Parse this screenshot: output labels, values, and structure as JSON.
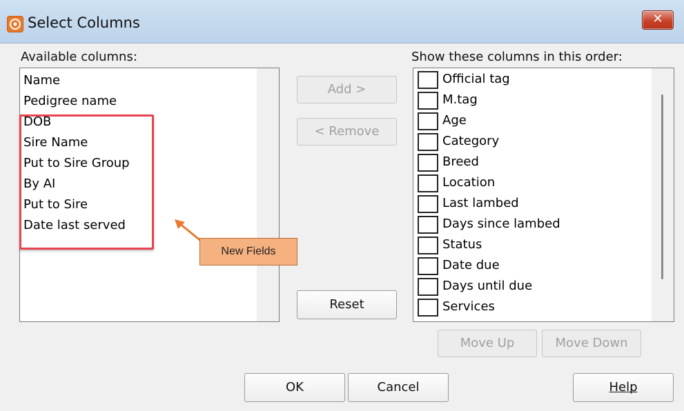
{
  "window": {
    "title": "Select Columns",
    "close_label": "✕"
  },
  "available": {
    "label": "Available columns:",
    "items": [
      "Name",
      "Pedigree name",
      "DOB",
      "Sire Name",
      "Put to Sire Group",
      "By AI",
      "Put to Sire",
      "Date last served"
    ]
  },
  "middle_buttons": {
    "add": "Add >",
    "remove": "< Remove",
    "reset": "Reset"
  },
  "shown": {
    "label": "Show these columns in this order:",
    "items": [
      "Official tag",
      "M.tag",
      "Age",
      "Category",
      "Breed",
      "Location",
      "Last lambed",
      "Days since lambed",
      "Status",
      "Date due",
      "Days until due",
      "Services"
    ]
  },
  "order_buttons": {
    "move_up": "Move Up",
    "move_down": "Move Down"
  },
  "footer": {
    "ok": "OK",
    "cancel": "Cancel",
    "help": "Help"
  },
  "annotation": {
    "callout": "New Fields",
    "highlight_color": "#e8434f",
    "callout_color": "#f6b180",
    "arrow_color": "#e8792e"
  }
}
